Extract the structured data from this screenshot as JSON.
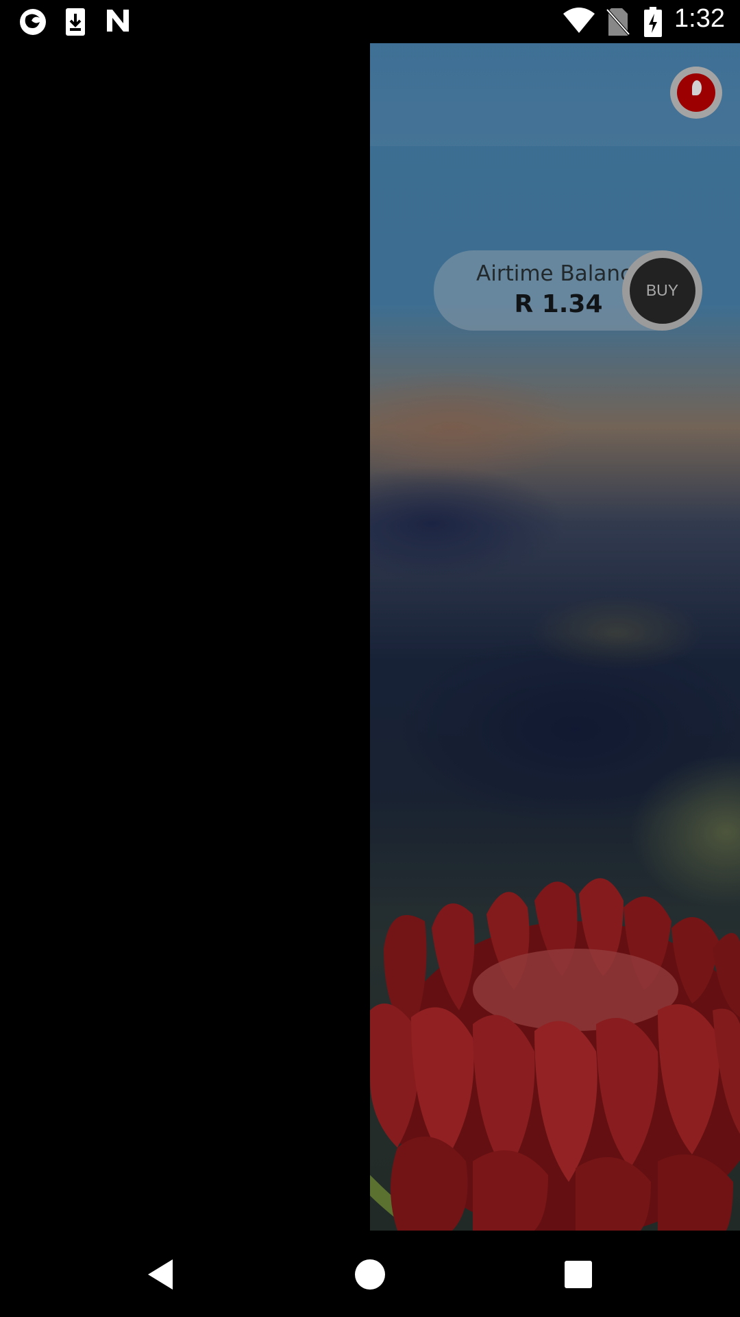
{
  "status_bar": {
    "time": "1:32",
    "icons": [
      "firefox-icon",
      "download-icon",
      "n-icon",
      "wifi-icon",
      "no-sim-icon",
      "battery-charging-icon"
    ]
  },
  "header": {
    "logo": "vodafone-logo"
  },
  "balance": {
    "label": "Airtime Balance",
    "amount": "R 1.34",
    "buy_label": "BUY"
  },
  "nav_bar": {
    "buttons": [
      "back-icon",
      "home-icon",
      "recents-icon"
    ]
  },
  "colors": {
    "accent": "#c00000",
    "sky": "#4a86b4"
  }
}
